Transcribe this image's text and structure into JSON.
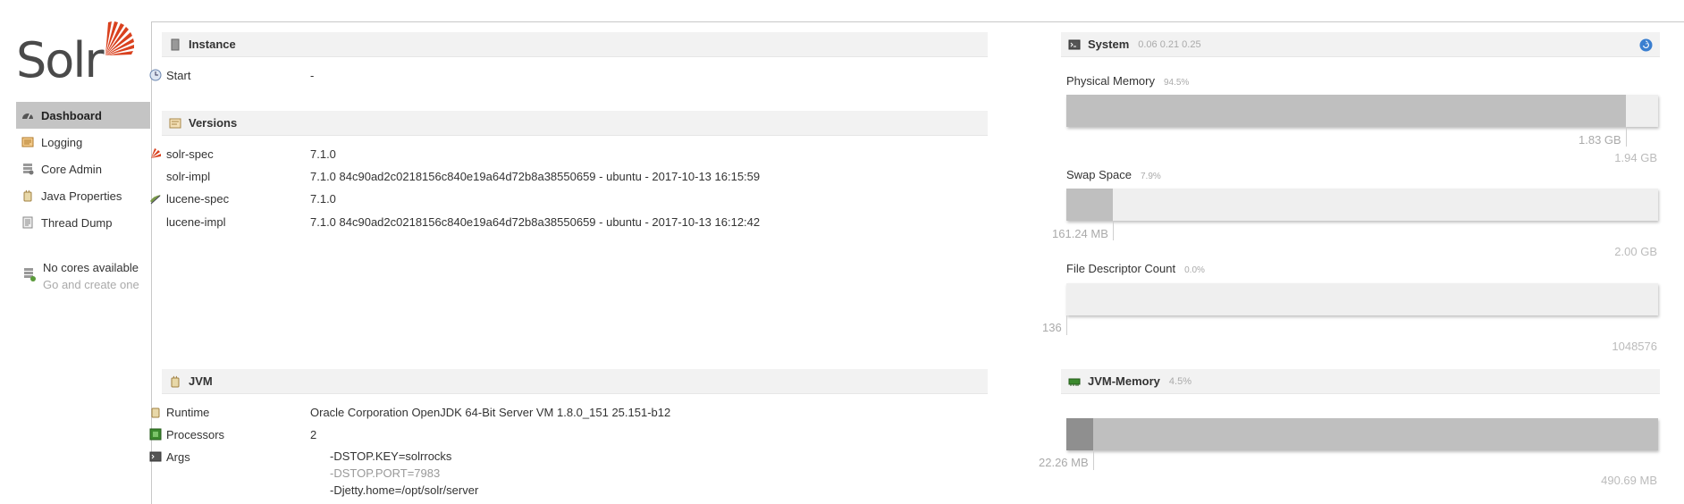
{
  "logo": {
    "text": "Solr"
  },
  "nav": [
    {
      "label": "Dashboard",
      "active": true,
      "icon": "dashboard-icon"
    },
    {
      "label": "Logging",
      "active": false,
      "icon": "logging-icon"
    },
    {
      "label": "Core Admin",
      "active": false,
      "icon": "core-admin-icon"
    },
    {
      "label": "Java Properties",
      "active": false,
      "icon": "java-properties-icon"
    },
    {
      "label": "Thread Dump",
      "active": false,
      "icon": "thread-dump-icon"
    }
  ],
  "no_cores": {
    "title": "No cores available",
    "subtitle": "Go and create one"
  },
  "instance": {
    "title": "Instance",
    "start_label": "Start",
    "start_value": "-"
  },
  "versions": {
    "title": "Versions",
    "rows": [
      {
        "key": "solr-spec",
        "value": "7.1.0"
      },
      {
        "key": "solr-impl",
        "value": "7.1.0 84c90ad2c0218156c840e19a64d72b8a38550659 - ubuntu - 2017-10-13 16:15:59"
      },
      {
        "key": "lucene-spec",
        "value": "7.1.0"
      },
      {
        "key": "lucene-impl",
        "value": "7.1.0 84c90ad2c0218156c840e19a64d72b8a38550659 - ubuntu - 2017-10-13 16:12:42"
      }
    ]
  },
  "jvm": {
    "title": "JVM",
    "runtime_label": "Runtime",
    "runtime_value": "Oracle Corporation OpenJDK 64-Bit Server VM 1.8.0_151 25.151-b12",
    "processors_label": "Processors",
    "processors_value": "2",
    "args_label": "Args",
    "args": [
      "-DSTOP.KEY=solrrocks",
      "-DSTOP.PORT=7983",
      "-Djetty.home=/opt/solr/server"
    ]
  },
  "system": {
    "title": "System",
    "load": "0.06 0.21 0.25",
    "physical_memory": {
      "label": "Physical Memory",
      "percent": "94.5%",
      "used": "1.83 GB",
      "total": "1.94 GB",
      "fraction": 0.945
    },
    "swap_space": {
      "label": "Swap Space",
      "percent": "7.9%",
      "used": "161.24 MB",
      "total": "2.00 GB",
      "fraction": 0.079
    },
    "file_descriptor": {
      "label": "File Descriptor Count",
      "percent": "0.0%",
      "used": "136",
      "total": "1048576",
      "fraction": 0.0
    }
  },
  "jvm_memory": {
    "title": "JVM-Memory",
    "percent": "4.5%",
    "used": "22.26 MB",
    "total": "490.69 MB",
    "used_fraction": 0.045,
    "committed_fraction": 1.0
  },
  "colors": {
    "solr_red": "#d9411e",
    "active_nav": "#c4c4c4",
    "bar_fill": "#bfbfbf",
    "bar_track": "#efefef"
  }
}
